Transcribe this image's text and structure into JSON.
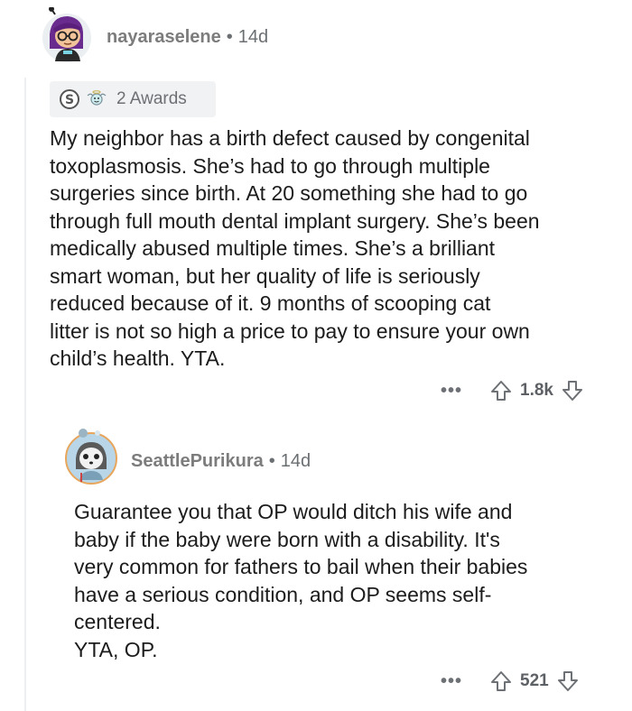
{
  "comment": {
    "username": "nayaraselene",
    "separator": "•",
    "age": "14d",
    "awards_label": "2 Awards",
    "body": "My neighbor has a birth defect caused by congenital\ntoxoplasmosis. She’s had to go through multiple\nsurgeries since birth. At 20 something she had to go\nthrough full mouth dental implant surgery. She’s been\nmedically abused multiple times. She’s a brilliant\nsmart woman, but her quality of life is seriously\nreduced because of it. 9 months of scooping cat\nlitter is not so high a price to pay to ensure your own\nchild’s health. YTA.",
    "more_label": "•••",
    "score": "1.8k"
  },
  "reply": {
    "username": "SeattlePurikura",
    "separator": "•",
    "age": "14d",
    "body": "Guarantee you that OP would ditch his wife and\nbaby if the baby were born with a disability. It's\nvery common for fathers to bail when their babies\nhave a serious condition, and OP seems self-\ncentered.\nYTA, OP.",
    "more_label": "•••",
    "score": "521"
  },
  "icons": {
    "upvote": "arrow-up-outline-icon",
    "downvote": "arrow-down-outline-icon",
    "award_silver": "silver-award-icon",
    "award_wholesome": "wholesome-award-icon"
  }
}
